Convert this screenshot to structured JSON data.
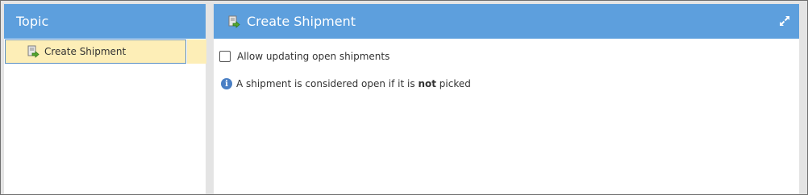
{
  "left_panel": {
    "title": "Topic",
    "items": [
      {
        "label": "Create Shipment",
        "icon": "document-arrow-icon",
        "selected": true
      }
    ]
  },
  "right_panel": {
    "title": "Create Shipment",
    "title_icon": "document-arrow-icon",
    "expand_icon": "expand-icon",
    "checkbox": {
      "label": "Allow updating open shipments",
      "checked": false
    },
    "info": {
      "icon": "info-icon",
      "before": "A shipment is considered open if it is ",
      "bold": "not",
      "after": " picked"
    }
  },
  "colors": {
    "header": "#5d9fdd",
    "selected_row": "#fdeeb7",
    "frame_bg": "#e4e4e4"
  }
}
